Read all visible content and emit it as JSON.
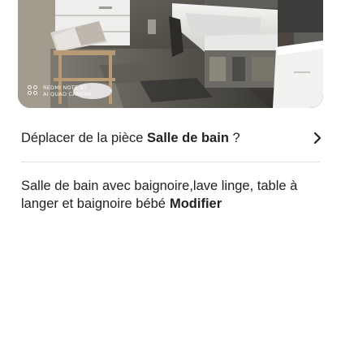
{
  "photo": {
    "watermark_line1": "REDMI NOTE 8T",
    "watermark_line2": "AI QUAD CAMERA",
    "watermark_icon": "camera-dots-icon"
  },
  "move_row": {
    "prefix": "Déplacer de la pièce",
    "room_name": "Salle de bain",
    "suffix": "?",
    "icon": "chevron-right-icon"
  },
  "description": {
    "text": "Salle de bain avec baignoire,lave linge, table à langer et baignoire bébé",
    "edit_label": "Modifier"
  },
  "colors": {
    "text": "#222222",
    "divider": "#e2e2e2"
  }
}
